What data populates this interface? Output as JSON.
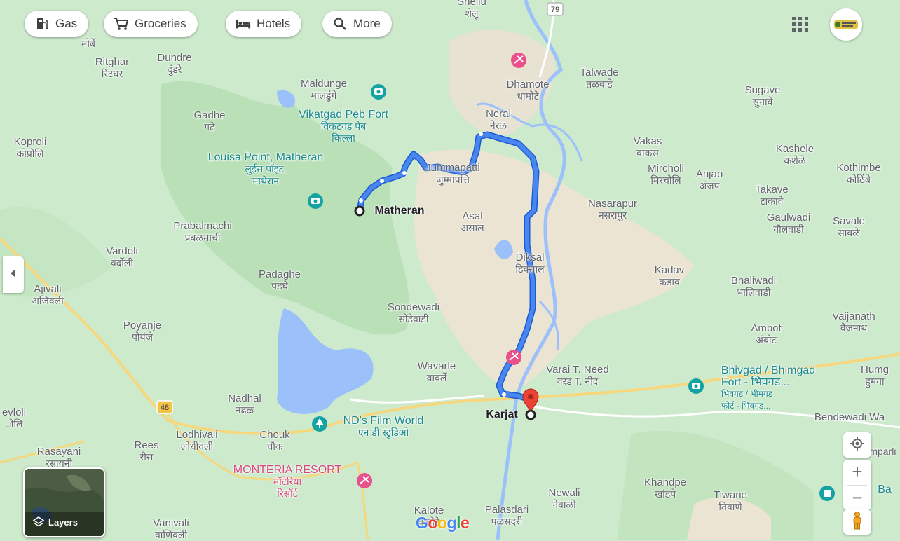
{
  "toolbar": {
    "chips": [
      {
        "label": "Gas",
        "icon": "gas-station-icon"
      },
      {
        "label": "Groceries",
        "icon": "shopping-cart-icon"
      },
      {
        "label": "Hotels",
        "icon": "bed-icon"
      },
      {
        "label": "More",
        "icon": "search-icon"
      }
    ],
    "apps_icon": "apps-grid-icon",
    "account_icon": "account-avatar-icon"
  },
  "route": {
    "origin": "Matheran",
    "destination": "Karjat",
    "color": "#3b78e7"
  },
  "places": [
    {
      "id": "sheilu",
      "l1": "Sheilu",
      "l2": "शेलू"
    },
    {
      "id": "morbe",
      "l1": "",
      "l2": "मोर्बे"
    },
    {
      "id": "ritghar",
      "l1": "Ritghar",
      "l2": "रिटघर"
    },
    {
      "id": "dundre",
      "l1": "Dundre",
      "l2": "दुंडरे"
    },
    {
      "id": "maldunge",
      "l1": "Maldunge",
      "l2": "मालडुंगे"
    },
    {
      "id": "gadhe",
      "l1": "Gadhe",
      "l2": "गढे"
    },
    {
      "id": "koproli",
      "l1": "Koproli",
      "l2": "कोप्रोलि"
    },
    {
      "id": "dhamote",
      "l1": "Dhamote",
      "l2": "धामोटे"
    },
    {
      "id": "talwade",
      "l1": "Talwade",
      "l2": "तळवाडे"
    },
    {
      "id": "sugave",
      "l1": "Sugave",
      "l2": "सुगावे"
    },
    {
      "id": "neral",
      "l1": "Neral",
      "l2": "नेरळ"
    },
    {
      "id": "vakas",
      "l1": "Vakas",
      "l2": "वाकस"
    },
    {
      "id": "kashele",
      "l1": "Kashele",
      "l2": "कशेळे"
    },
    {
      "id": "mircholi",
      "l1": "Mircholi",
      "l2": "मिरचोलि"
    },
    {
      "id": "anjap",
      "l1": "Anjap",
      "l2": "अंजप"
    },
    {
      "id": "kothimbe",
      "l1": "Kothimbe",
      "l2": "कोठिंबे"
    },
    {
      "id": "jummapatti",
      "l1": "Jummapatti",
      "l2": "जुम्मापत्ति"
    },
    {
      "id": "takave",
      "l1": "Takave",
      "l2": "टाकावे"
    },
    {
      "id": "gaulwadi",
      "l1": "Gaulwadi",
      "l2": "गौलवाडी"
    },
    {
      "id": "nasarapur",
      "l1": "Nasarapur",
      "l2": "नसरापुर"
    },
    {
      "id": "asal",
      "l1": "Asal",
      "l2": "असाल"
    },
    {
      "id": "savale",
      "l1": "Savale",
      "l2": "सावळे"
    },
    {
      "id": "prabalmachi",
      "l1": "Prabalmachi",
      "l2": "प्रबळमाची"
    },
    {
      "id": "vardoli",
      "l1": "Vardoli",
      "l2": "वर्दोली"
    },
    {
      "id": "diksal",
      "l1": "Diksal",
      "l2": "डिक्साल"
    },
    {
      "id": "padaghe",
      "l1": "Padaghe",
      "l2": "पडघे"
    },
    {
      "id": "kadav",
      "l1": "Kadav",
      "l2": "कडाव"
    },
    {
      "id": "bhaliwadi",
      "l1": "Bhaliwadi",
      "l2": "भालिवाडी"
    },
    {
      "id": "ajivali",
      "l1": "Ajivali",
      "l2": "अजिवली"
    },
    {
      "id": "sondewadi",
      "l1": "Sondewadi",
      "l2": "सोंडेवाडी"
    },
    {
      "id": "vaijanath",
      "l1": "Vaijanath",
      "l2": "वैजनाथ"
    },
    {
      "id": "poyanje",
      "l1": "Poyanje",
      "l2": "पोयंजे"
    },
    {
      "id": "ambot",
      "l1": "Ambot",
      "l2": "अंबोट"
    },
    {
      "id": "wavarle",
      "l1": "Wavarle",
      "l2": "वावर्ले"
    },
    {
      "id": "varai",
      "l1": "Varai T. Need",
      "l2": "वरड T. नीद"
    },
    {
      "id": "humg",
      "l1": "Humg",
      "l2": "हुमगा"
    },
    {
      "id": "nadhal",
      "l1": "Nadhal",
      "l2": "नंढळ"
    },
    {
      "id": "evloli",
      "l1": "evloli",
      "l2": "ोलि"
    },
    {
      "id": "bendewadi",
      "l1": "Bendewadi Wa",
      "l2": ""
    },
    {
      "id": "lodhivali",
      "l1": "Lodhivali",
      "l2": "लोधीवली"
    },
    {
      "id": "chouk",
      "l1": "Chouk",
      "l2": "चौक"
    },
    {
      "id": "rees",
      "l1": "Rees",
      "l2": "रीस"
    },
    {
      "id": "rasayani",
      "l1": "Rasayani",
      "l2": "रसायनी"
    },
    {
      "id": "khandpe",
      "l1": "Khandpe",
      "l2": "खांडपे"
    },
    {
      "id": "tiwane",
      "l1": "Tiwane",
      "l2": "तिवाणे"
    },
    {
      "id": "newali",
      "l1": "Newali",
      "l2": "नेवाळी"
    },
    {
      "id": "kalote",
      "l1": "Kalote",
      "l2": "कलोटे"
    },
    {
      "id": "palasdari",
      "l1": "Palasdari",
      "l2": "पळसदरी"
    },
    {
      "id": "vanivali",
      "l1": "Vanivali",
      "l2": "वाणिवली"
    },
    {
      "id": "tempsoarli",
      "l1": "",
      "l2": "Temparli"
    },
    {
      "id": "ba",
      "l1": "Ba",
      "l2": ""
    }
  ],
  "pois": {
    "vikatgad": {
      "l1": "Vikatgad Peb Fort",
      "l2": "विकटगड पेब",
      "l3": "किल्ला"
    },
    "louisa": {
      "l1": "Louisa Point, Matheran",
      "l2": "लुईस पॉइंट,",
      "l3": "माथेरान"
    },
    "bhivgad": {
      "l1": "Bhivgad / Bhimgad",
      "l2": "Fort - भिवगड...",
      "l3": "भिवगड / भीमगड",
      "l4": "फोर्ट - भिवगड..."
    },
    "ndfilm": {
      "l1": "ND's Film World",
      "l2": "एन डी स्टुडिओ"
    },
    "monteria": {
      "l1": "MONTERIA RESORT",
      "l2": "मॉटेरिया",
      "l3": "रिसॉर्ट"
    }
  },
  "roads": {
    "nh48": "48",
    "sh79": "79"
  },
  "layers": {
    "label": "Layers"
  },
  "google_logo": "Google",
  "controls": {
    "locate": "my-location-icon",
    "zoom_in": "+",
    "zoom_out": "−",
    "pegman": "pegman-icon",
    "collapse": "collapse-left-icon"
  }
}
